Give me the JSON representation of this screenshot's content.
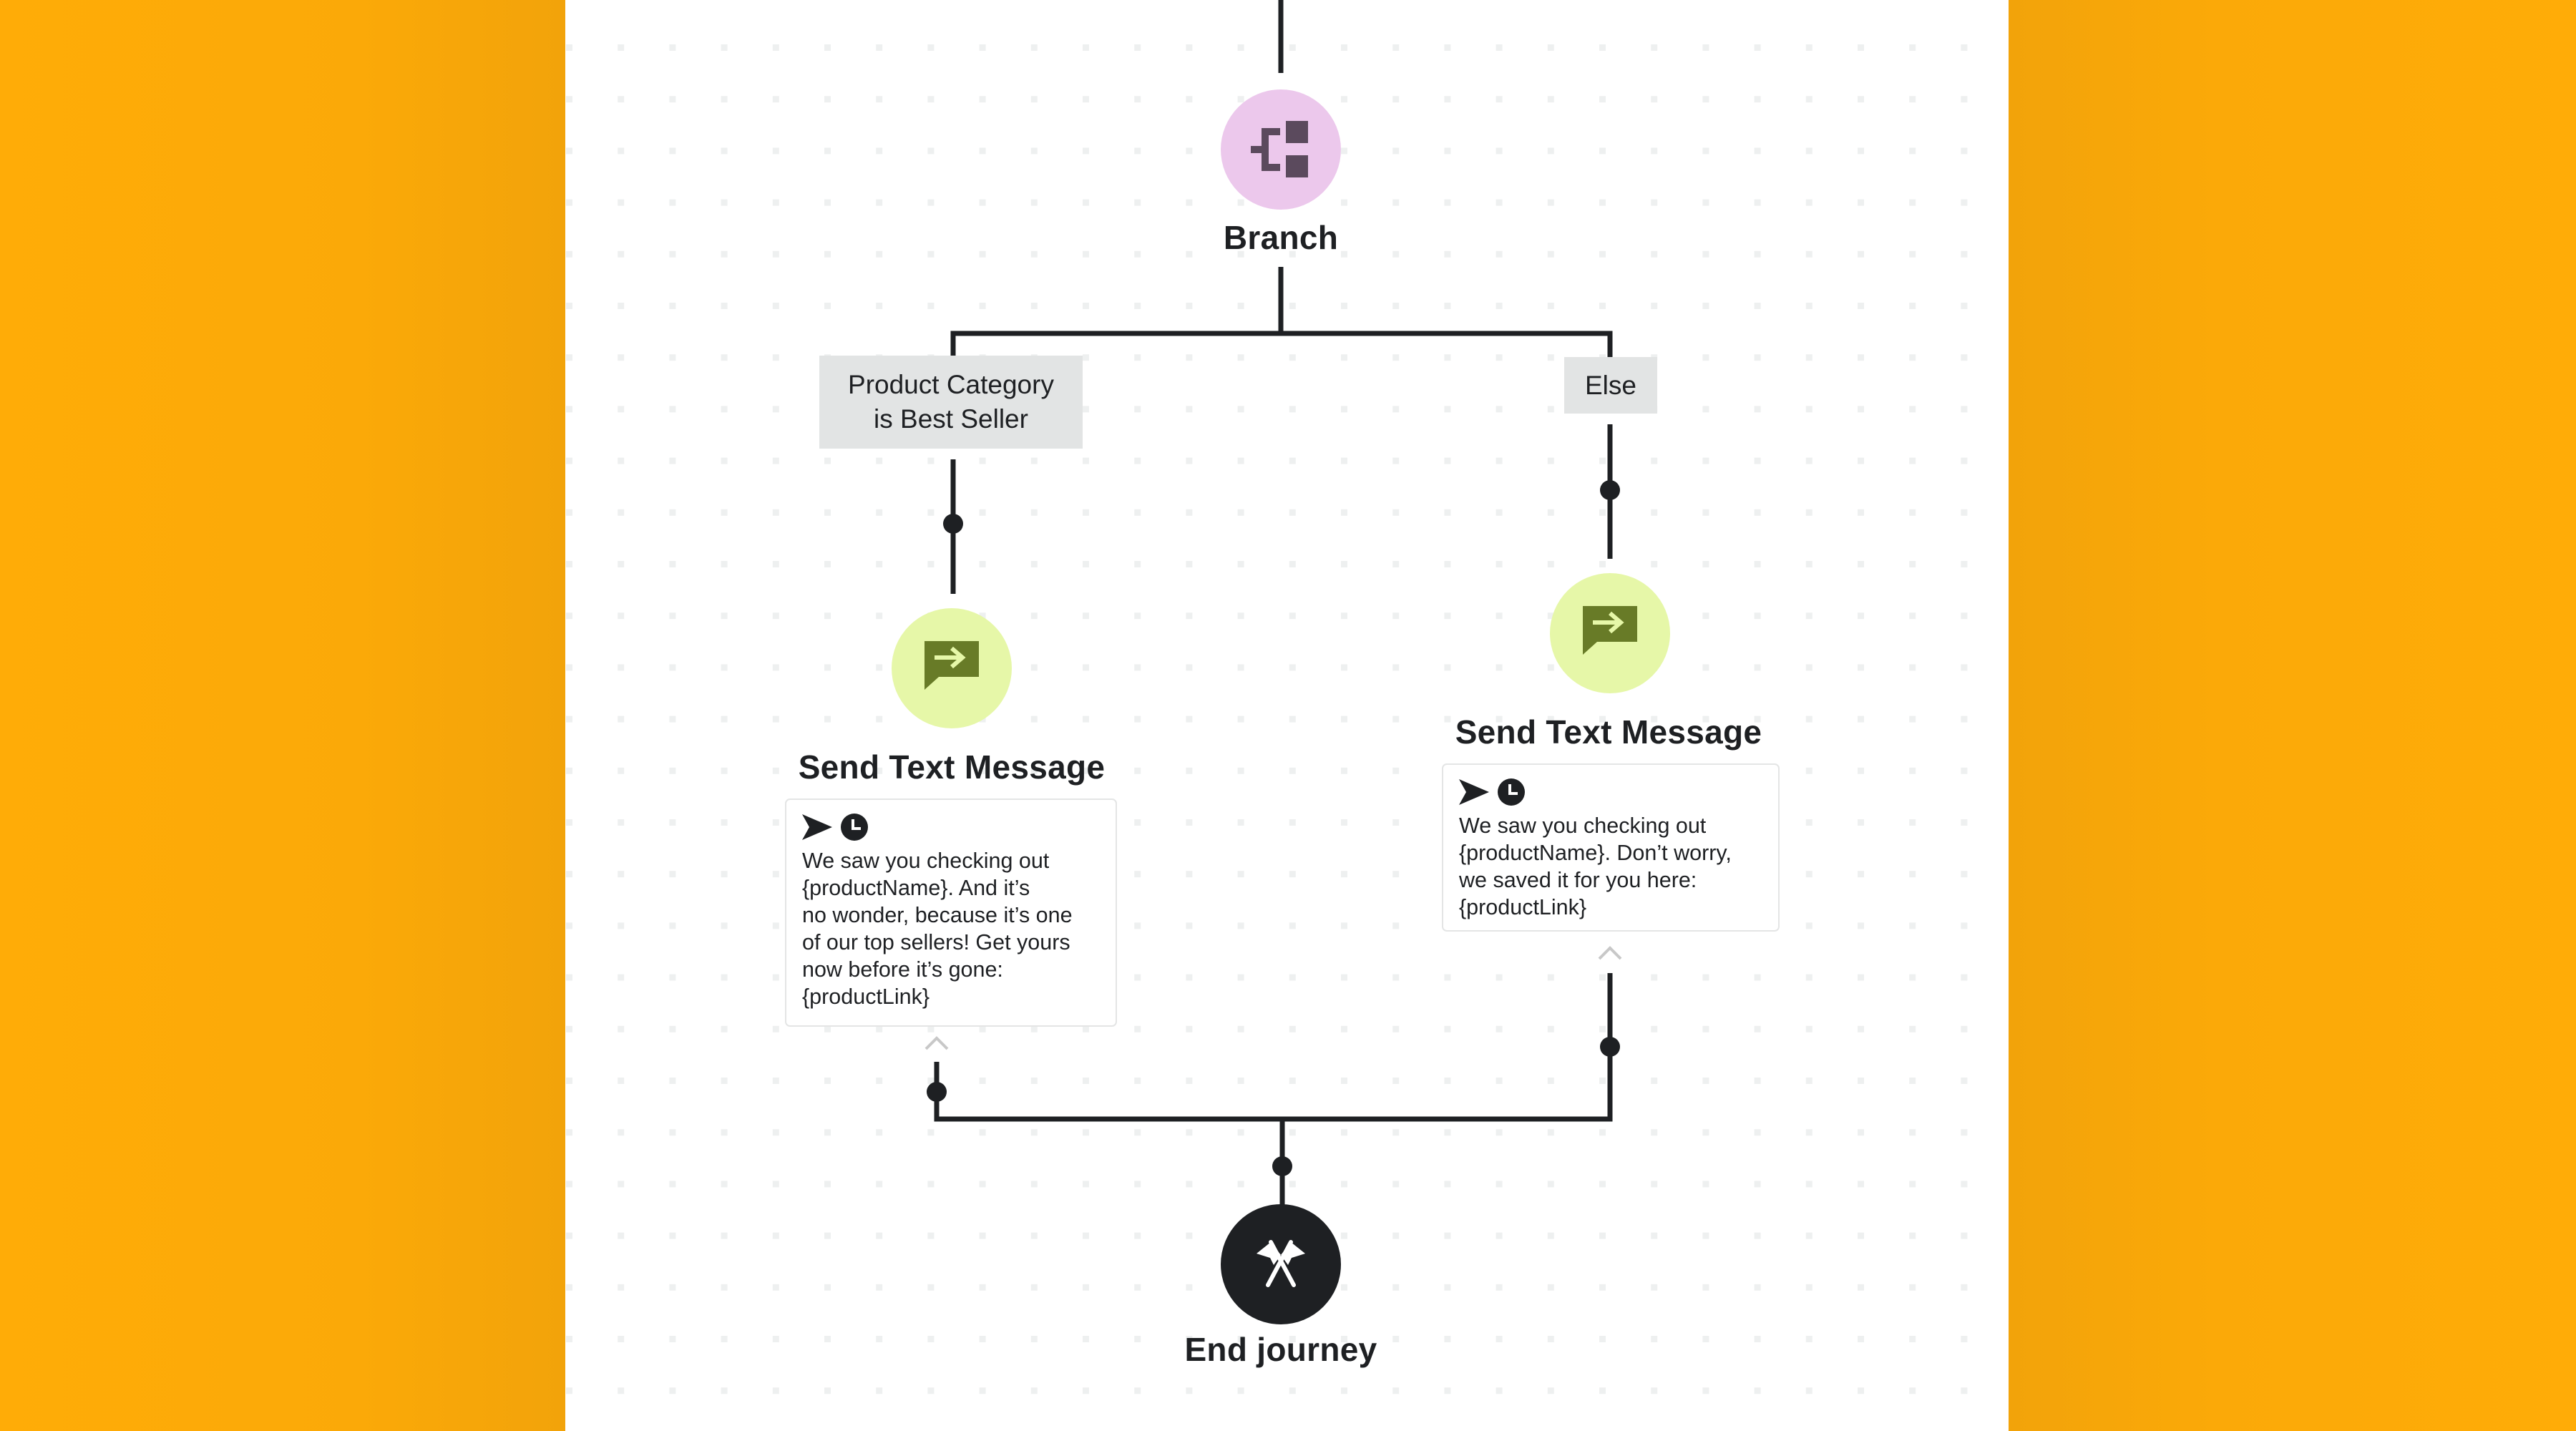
{
  "colors": {
    "background_orange": "#f8a709",
    "canvas": "#ffffff",
    "grid_dot": "#eef0f0",
    "wire": "#1e2023",
    "branch_node_bg": "#ecc8ec",
    "branch_icon": "#5b4a5d",
    "message_node_bg": "#e6f7a8",
    "message_icon": "#687b27",
    "end_node_bg": "#1e2023",
    "condition_label_bg": "#e2e4e4",
    "caret": "#c8c8c8"
  },
  "journey": {
    "branch_node": {
      "icon": "branch-icon",
      "title": "Branch"
    },
    "paths": [
      {
        "condition": "Product Category\nis Best Seller",
        "step": {
          "icon": "send-message-icon",
          "title": "Send Text Message",
          "meta_icons": [
            "send-icon",
            "clock-icon"
          ],
          "message": "We saw you checking out\n{productName}. And it’s\nno wonder, because it’s one\nof our top sellers! Get yours\nnow before it’s gone:\n{productLink}"
        }
      },
      {
        "condition": "Else",
        "step": {
          "icon": "send-message-icon",
          "title": "Send Text Message",
          "meta_icons": [
            "send-icon",
            "clock-icon"
          ],
          "message": "We saw you checking out\n{productName}. Don’t worry,\nwe saved it for you here:\n{productLink}"
        }
      }
    ],
    "end_node": {
      "icon": "crossed-flags-icon",
      "title": "End journey"
    }
  }
}
